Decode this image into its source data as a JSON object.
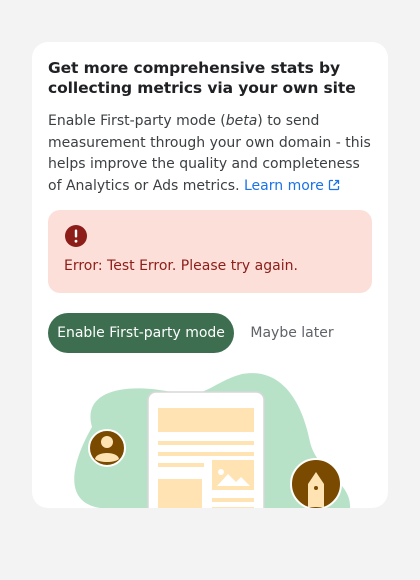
{
  "panel": {
    "title": "Get more comprehensive stats by collecting metrics via your own site",
    "description_before": "Enable First-party mode (",
    "description_beta": "beta",
    "description_after": ") to send measurement through your own domain - this helps improve the quality and completeness of Analytics or Ads metrics.",
    "learn_more_label": "Learn more"
  },
  "error": {
    "icon": "error-circle-icon",
    "message": "Error: Test Error. Please try again."
  },
  "actions": {
    "primary_label": "Enable First-party mode",
    "secondary_label": "Maybe later"
  },
  "colors": {
    "primary": "#3c6e4f",
    "link": "#1a73e8",
    "error_bg": "#fcdfd9",
    "error_text": "#8c1d18",
    "illustration_blob": "#b8e2c8",
    "illustration_accent": "#ffe3b3",
    "avatar_brown": "#7a4a00"
  }
}
